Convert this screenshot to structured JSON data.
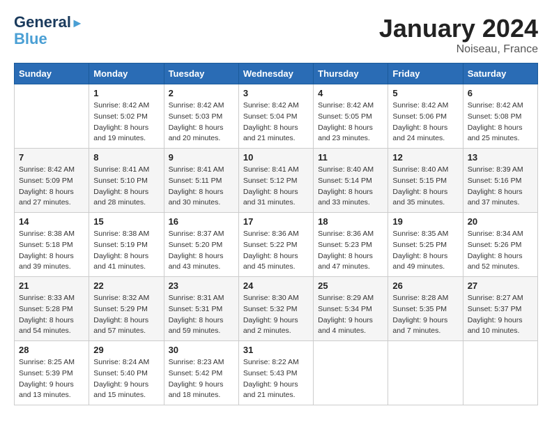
{
  "header": {
    "logo_line1": "General",
    "logo_line2": "Blue",
    "month_year": "January 2024",
    "location": "Noiseau, France"
  },
  "weekdays": [
    "Sunday",
    "Monday",
    "Tuesday",
    "Wednesday",
    "Thursday",
    "Friday",
    "Saturday"
  ],
  "weeks": [
    [
      {
        "day": "",
        "sunrise": "",
        "sunset": "",
        "daylight": ""
      },
      {
        "day": "1",
        "sunrise": "Sunrise: 8:42 AM",
        "sunset": "Sunset: 5:02 PM",
        "daylight": "Daylight: 8 hours and 19 minutes."
      },
      {
        "day": "2",
        "sunrise": "Sunrise: 8:42 AM",
        "sunset": "Sunset: 5:03 PM",
        "daylight": "Daylight: 8 hours and 20 minutes."
      },
      {
        "day": "3",
        "sunrise": "Sunrise: 8:42 AM",
        "sunset": "Sunset: 5:04 PM",
        "daylight": "Daylight: 8 hours and 21 minutes."
      },
      {
        "day": "4",
        "sunrise": "Sunrise: 8:42 AM",
        "sunset": "Sunset: 5:05 PM",
        "daylight": "Daylight: 8 hours and 23 minutes."
      },
      {
        "day": "5",
        "sunrise": "Sunrise: 8:42 AM",
        "sunset": "Sunset: 5:06 PM",
        "daylight": "Daylight: 8 hours and 24 minutes."
      },
      {
        "day": "6",
        "sunrise": "Sunrise: 8:42 AM",
        "sunset": "Sunset: 5:08 PM",
        "daylight": "Daylight: 8 hours and 25 minutes."
      }
    ],
    [
      {
        "day": "7",
        "sunrise": "Sunrise: 8:42 AM",
        "sunset": "Sunset: 5:09 PM",
        "daylight": "Daylight: 8 hours and 27 minutes."
      },
      {
        "day": "8",
        "sunrise": "Sunrise: 8:41 AM",
        "sunset": "Sunset: 5:10 PM",
        "daylight": "Daylight: 8 hours and 28 minutes."
      },
      {
        "day": "9",
        "sunrise": "Sunrise: 8:41 AM",
        "sunset": "Sunset: 5:11 PM",
        "daylight": "Daylight: 8 hours and 30 minutes."
      },
      {
        "day": "10",
        "sunrise": "Sunrise: 8:41 AM",
        "sunset": "Sunset: 5:12 PM",
        "daylight": "Daylight: 8 hours and 31 minutes."
      },
      {
        "day": "11",
        "sunrise": "Sunrise: 8:40 AM",
        "sunset": "Sunset: 5:14 PM",
        "daylight": "Daylight: 8 hours and 33 minutes."
      },
      {
        "day": "12",
        "sunrise": "Sunrise: 8:40 AM",
        "sunset": "Sunset: 5:15 PM",
        "daylight": "Daylight: 8 hours and 35 minutes."
      },
      {
        "day": "13",
        "sunrise": "Sunrise: 8:39 AM",
        "sunset": "Sunset: 5:16 PM",
        "daylight": "Daylight: 8 hours and 37 minutes."
      }
    ],
    [
      {
        "day": "14",
        "sunrise": "Sunrise: 8:38 AM",
        "sunset": "Sunset: 5:18 PM",
        "daylight": "Daylight: 8 hours and 39 minutes."
      },
      {
        "day": "15",
        "sunrise": "Sunrise: 8:38 AM",
        "sunset": "Sunset: 5:19 PM",
        "daylight": "Daylight: 8 hours and 41 minutes."
      },
      {
        "day": "16",
        "sunrise": "Sunrise: 8:37 AM",
        "sunset": "Sunset: 5:20 PM",
        "daylight": "Daylight: 8 hours and 43 minutes."
      },
      {
        "day": "17",
        "sunrise": "Sunrise: 8:36 AM",
        "sunset": "Sunset: 5:22 PM",
        "daylight": "Daylight: 8 hours and 45 minutes."
      },
      {
        "day": "18",
        "sunrise": "Sunrise: 8:36 AM",
        "sunset": "Sunset: 5:23 PM",
        "daylight": "Daylight: 8 hours and 47 minutes."
      },
      {
        "day": "19",
        "sunrise": "Sunrise: 8:35 AM",
        "sunset": "Sunset: 5:25 PM",
        "daylight": "Daylight: 8 hours and 49 minutes."
      },
      {
        "day": "20",
        "sunrise": "Sunrise: 8:34 AM",
        "sunset": "Sunset: 5:26 PM",
        "daylight": "Daylight: 8 hours and 52 minutes."
      }
    ],
    [
      {
        "day": "21",
        "sunrise": "Sunrise: 8:33 AM",
        "sunset": "Sunset: 5:28 PM",
        "daylight": "Daylight: 8 hours and 54 minutes."
      },
      {
        "day": "22",
        "sunrise": "Sunrise: 8:32 AM",
        "sunset": "Sunset: 5:29 PM",
        "daylight": "Daylight: 8 hours and 57 minutes."
      },
      {
        "day": "23",
        "sunrise": "Sunrise: 8:31 AM",
        "sunset": "Sunset: 5:31 PM",
        "daylight": "Daylight: 8 hours and 59 minutes."
      },
      {
        "day": "24",
        "sunrise": "Sunrise: 8:30 AM",
        "sunset": "Sunset: 5:32 PM",
        "daylight": "Daylight: 9 hours and 2 minutes."
      },
      {
        "day": "25",
        "sunrise": "Sunrise: 8:29 AM",
        "sunset": "Sunset: 5:34 PM",
        "daylight": "Daylight: 9 hours and 4 minutes."
      },
      {
        "day": "26",
        "sunrise": "Sunrise: 8:28 AM",
        "sunset": "Sunset: 5:35 PM",
        "daylight": "Daylight: 9 hours and 7 minutes."
      },
      {
        "day": "27",
        "sunrise": "Sunrise: 8:27 AM",
        "sunset": "Sunset: 5:37 PM",
        "daylight": "Daylight: 9 hours and 10 minutes."
      }
    ],
    [
      {
        "day": "28",
        "sunrise": "Sunrise: 8:25 AM",
        "sunset": "Sunset: 5:39 PM",
        "daylight": "Daylight: 9 hours and 13 minutes."
      },
      {
        "day": "29",
        "sunrise": "Sunrise: 8:24 AM",
        "sunset": "Sunset: 5:40 PM",
        "daylight": "Daylight: 9 hours and 15 minutes."
      },
      {
        "day": "30",
        "sunrise": "Sunrise: 8:23 AM",
        "sunset": "Sunset: 5:42 PM",
        "daylight": "Daylight: 9 hours and 18 minutes."
      },
      {
        "day": "31",
        "sunrise": "Sunrise: 8:22 AM",
        "sunset": "Sunset: 5:43 PM",
        "daylight": "Daylight: 9 hours and 21 minutes."
      },
      {
        "day": "",
        "sunrise": "",
        "sunset": "",
        "daylight": ""
      },
      {
        "day": "",
        "sunrise": "",
        "sunset": "",
        "daylight": ""
      },
      {
        "day": "",
        "sunrise": "",
        "sunset": "",
        "daylight": ""
      }
    ]
  ]
}
